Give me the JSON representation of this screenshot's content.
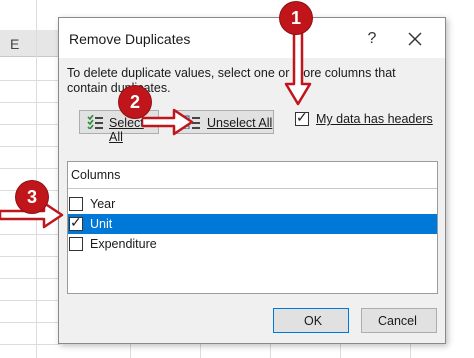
{
  "sheet": {
    "column_header": "E"
  },
  "dialog": {
    "title": "Remove Duplicates",
    "help_label": "?",
    "close_label": "X",
    "description": "To delete duplicate values, select one or more columns that contain duplicates.",
    "buttons": {
      "select_all": "Select All",
      "unselect_all": "Unselect All",
      "ok": "OK",
      "cancel": "Cancel"
    },
    "headers_checkbox": {
      "label": "My data has headers",
      "checked": true
    },
    "columns_list": {
      "header": "Columns",
      "items": [
        {
          "label": "Year",
          "checked": false,
          "selected": false
        },
        {
          "label": "Unit",
          "checked": true,
          "selected": true
        },
        {
          "label": "Expenditure",
          "checked": false,
          "selected": false
        }
      ]
    }
  },
  "callouts": [
    {
      "number": "1"
    },
    {
      "number": "2"
    },
    {
      "number": "3"
    }
  ],
  "colors": {
    "callout_red": "#c0151b",
    "selection_blue": "#0078d7"
  }
}
